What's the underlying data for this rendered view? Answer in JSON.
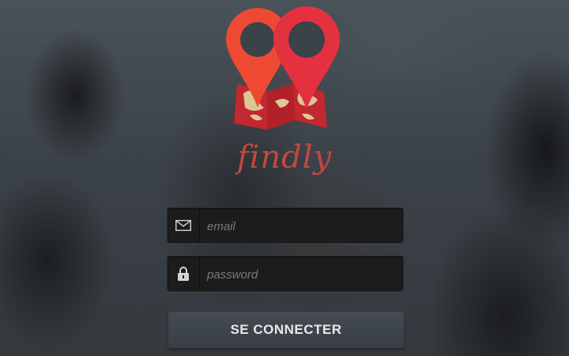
{
  "app": {
    "name": "findly"
  },
  "login": {
    "email_placeholder": "email",
    "password_placeholder": "password",
    "submit_label": "SE CONNECTER"
  },
  "icons": {
    "email": "envelope-icon",
    "password": "lock-icon",
    "logo": "map-pins-logo"
  },
  "colors": {
    "brand": "#c3473f",
    "pin_left": "#ee4a33",
    "pin_right": "#e4313f",
    "map_red": "#c2282f",
    "map_beige": "#ddc795"
  }
}
